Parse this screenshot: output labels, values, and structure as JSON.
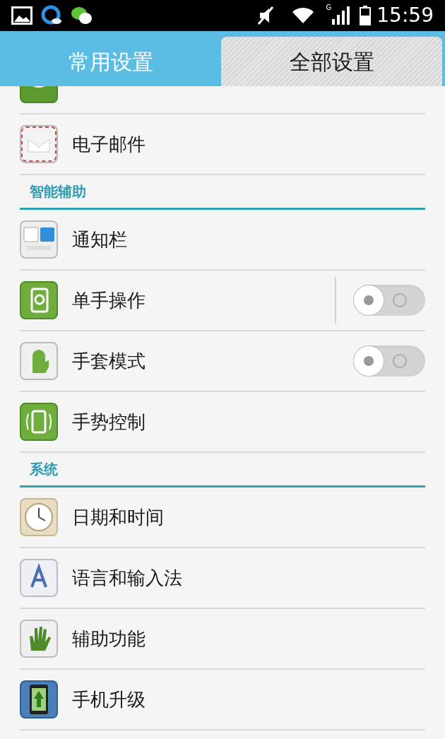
{
  "status_bar": {
    "network": "G",
    "time": "15:59"
  },
  "tabs": [
    {
      "label": "常用设置",
      "selected": false
    },
    {
      "label": "全部设置",
      "selected": true
    }
  ],
  "list": [
    {
      "kind": "clipped"
    },
    {
      "kind": "item",
      "label": "电子邮件"
    },
    {
      "kind": "header",
      "label": "智能辅助"
    },
    {
      "kind": "item",
      "label": "通知栏"
    },
    {
      "kind": "toggle",
      "label": "单手操作",
      "checked": false,
      "divider": true
    },
    {
      "kind": "toggle",
      "label": "手套模式",
      "checked": false
    },
    {
      "kind": "item",
      "label": "手势控制"
    },
    {
      "kind": "header",
      "label": "系统"
    },
    {
      "kind": "item",
      "label": "日期和时间"
    },
    {
      "kind": "item",
      "label": "语言和输入法"
    },
    {
      "kind": "item",
      "label": "辅助功能"
    },
    {
      "kind": "item",
      "label": "手机升级"
    }
  ]
}
